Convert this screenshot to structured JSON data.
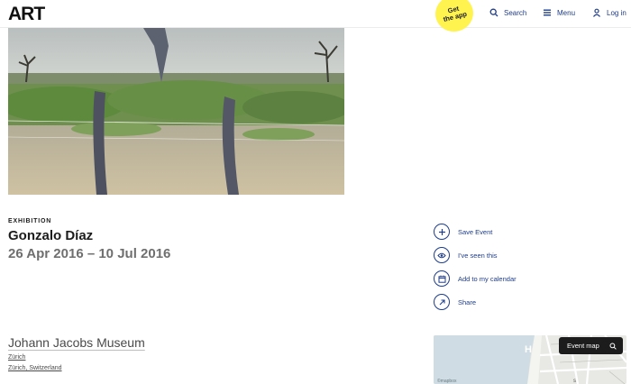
{
  "header": {
    "logo_text": "ART",
    "get_app": "Get\nthe app",
    "nav": [
      {
        "label": "Search",
        "icon": "search-icon"
      },
      {
        "label": "Menu",
        "icon": "menu-icon"
      },
      {
        "label": "Log in",
        "icon": "user-icon"
      }
    ]
  },
  "event": {
    "type": "EXHIBITION",
    "title": "Gonzalo Díaz",
    "dates": "26 Apr 2016 – 10 Jul 2016"
  },
  "actions": [
    {
      "label": "Save Event",
      "icon": "plus-icon"
    },
    {
      "label": "I've seen this",
      "icon": "eye-icon"
    },
    {
      "label": "Add to my calendar",
      "icon": "calendar-icon"
    },
    {
      "label": "Share",
      "icon": "share-arrow-icon"
    }
  ],
  "venue": {
    "name": "Johann Jacobs Museum",
    "city": "Zürich",
    "city_country": "Zürich, Switzerland"
  },
  "map": {
    "button_label": "Event map",
    "attribution": "©mapbox"
  },
  "colors": {
    "accent": "#1f3c88",
    "app_badge": "#fff34f",
    "date_gray": "#6f6f6f"
  }
}
